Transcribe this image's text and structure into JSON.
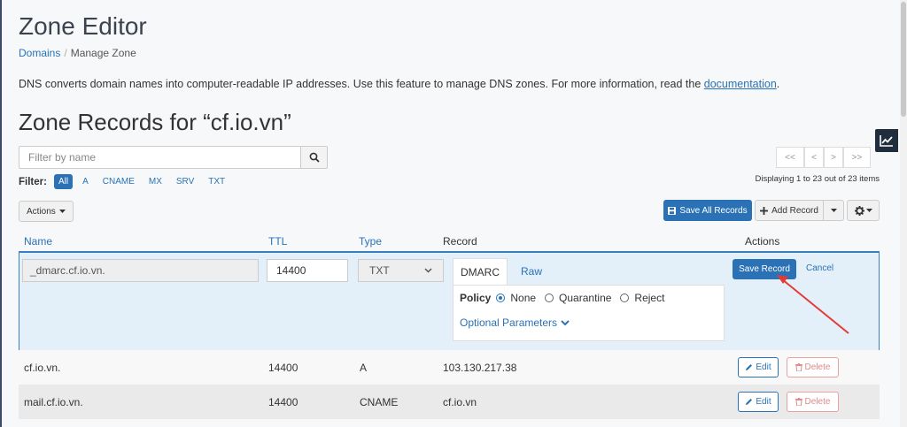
{
  "header": {
    "title": "Zone Editor",
    "breadcrumb_link": "Domains",
    "breadcrumb_sep": "/",
    "breadcrumb_current": "Manage Zone"
  },
  "description": {
    "text": "DNS converts domain names into computer-readable IP addresses. Use this feature to manage DNS zones. For more information, read the ",
    "link": "documentation",
    "suffix": "."
  },
  "zone_title": "Zone Records for “cf.io.vn”",
  "search": {
    "placeholder": "Filter by name"
  },
  "filter": {
    "label": "Filter:",
    "options": [
      "All",
      "A",
      "CNAME",
      "MX",
      "SRV",
      "TXT"
    ],
    "active": "All"
  },
  "pagination": {
    "first": "<<",
    "prev": "<",
    "next": ">",
    "last": ">>"
  },
  "display_info": "Displaying 1 to 23 out of 23 items",
  "toolbar": {
    "actions_label": "Actions",
    "save_all_label": "Save All Records",
    "add_record_label": "Add Record"
  },
  "table": {
    "headers": {
      "name": "Name",
      "ttl": "TTL",
      "type": "Type",
      "record": "Record",
      "actions": "Actions"
    }
  },
  "edit_row": {
    "name": "_dmarc.cf.io.vn.",
    "ttl": "14400",
    "type": "TXT",
    "tabs": [
      "DMARC",
      "Raw"
    ],
    "policy_label": "Policy",
    "policy_options": [
      "None",
      "Quarantine",
      "Reject"
    ],
    "policy_selected": "None",
    "optional_params": "Optional Parameters",
    "save_label": "Save Record",
    "cancel_label": "Cancel"
  },
  "rows": [
    {
      "name": "cf.io.vn.",
      "ttl": "14400",
      "type": "A",
      "record": "103.130.217.38"
    },
    {
      "name": "mail.cf.io.vn.",
      "ttl": "14400",
      "type": "CNAME",
      "record": "cf.io.vn"
    }
  ],
  "row_actions": {
    "edit": "Edit",
    "delete": "Delete"
  },
  "colors": {
    "accent": "#2a72b5",
    "edit_row_bg": "#e3eff9",
    "annotation_arrow": "#e53935",
    "delete": "#e08a8a"
  },
  "icons": {
    "search": "search-icon",
    "save": "floppy-icon",
    "add": "plus-icon",
    "settings": "gear-icon",
    "chart": "chart-icon",
    "edit": "pencil-icon",
    "delete": "trash-icon",
    "optional": "chevron-down-icon"
  }
}
